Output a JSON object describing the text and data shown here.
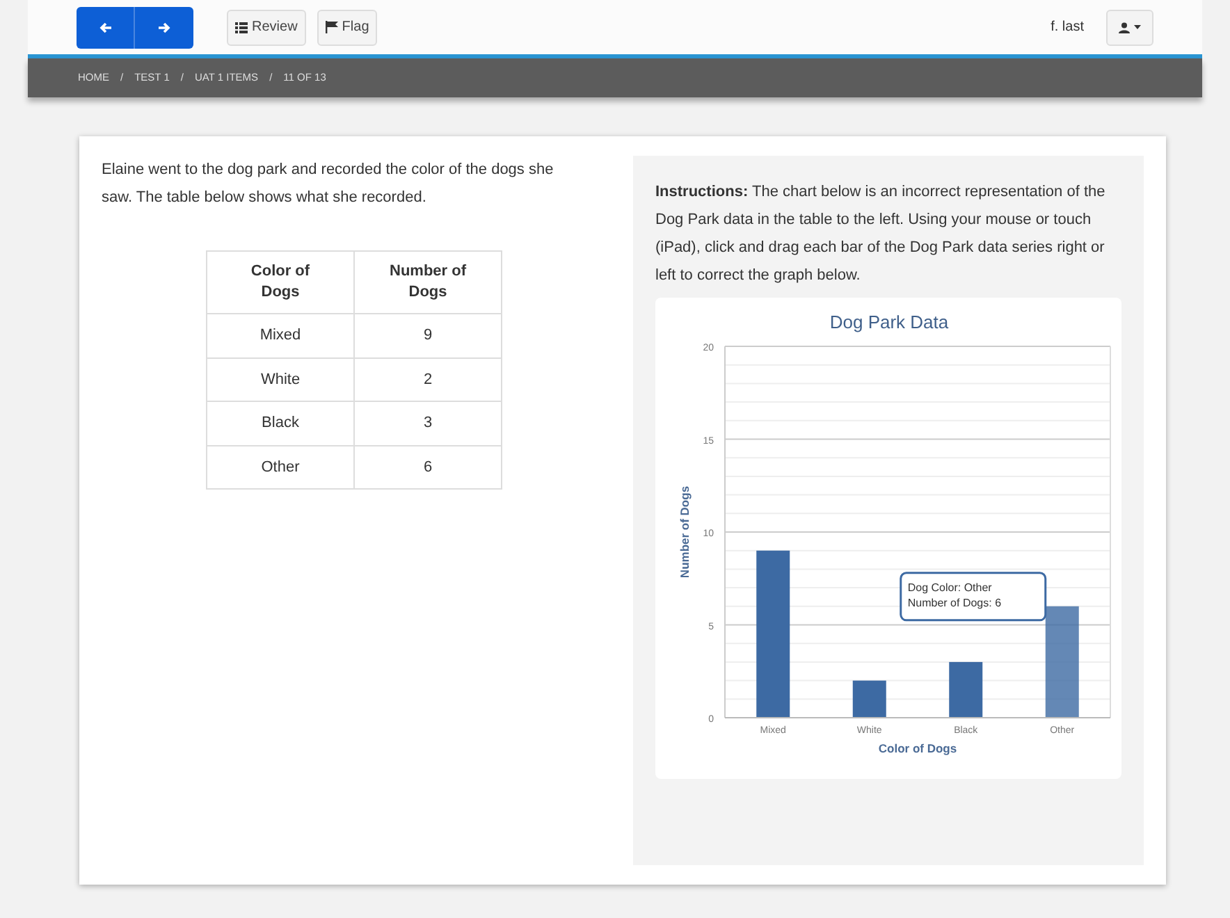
{
  "toolbar": {
    "nav_buttons": [
      {
        "kind": "back"
      },
      {
        "kind": "forward"
      }
    ],
    "tool_buttons": [
      {
        "label": "Review",
        "kind": "review"
      },
      {
        "label": "Flag",
        "kind": "flag"
      }
    ],
    "user_name": "f. last"
  },
  "breadcrumb": {
    "separator": "/",
    "items": [
      "HOME",
      "TEST 1",
      "UAT 1 ITEMS",
      "11 OF 13"
    ]
  },
  "question": {
    "text": "Elaine went to the dog park and recorded the color of the dogs she saw. The table below shows what she recorded.",
    "table": {
      "columns": [
        "Color of Dogs",
        "Number of Dogs"
      ],
      "rows": [
        [
          "Mixed",
          "9"
        ],
        [
          "White",
          "2"
        ],
        [
          "Black",
          "3"
        ],
        [
          "Other",
          "6"
        ]
      ]
    }
  },
  "instructions": "**Instructions:** The chart below is an incorrect representation of the Dog Park data in the table to the left. Using your mouse or touch (iPad), click and drag each bar of the Dog Park data series right or left to correct the graph below.",
  "chart_data": {
    "type": "bar",
    "title": "Dog Park Data",
    "xlabel": "Color of Dogs",
    "ylabel": "Number of Dogs",
    "categories": [
      "Mixed",
      "White",
      "Black",
      "Other"
    ],
    "series": [
      {
        "color": "#3d6aa3",
        "values": [
          9,
          2,
          3,
          6
        ]
      }
    ],
    "ylim": [
      0,
      20
    ],
    "yticks": [
      0,
      5,
      10,
      15,
      20
    ],
    "grid": true
  },
  "tooltip": {
    "lines": [
      "Dog Color: Other",
      "Number of Dogs: 6"
    ]
  }
}
